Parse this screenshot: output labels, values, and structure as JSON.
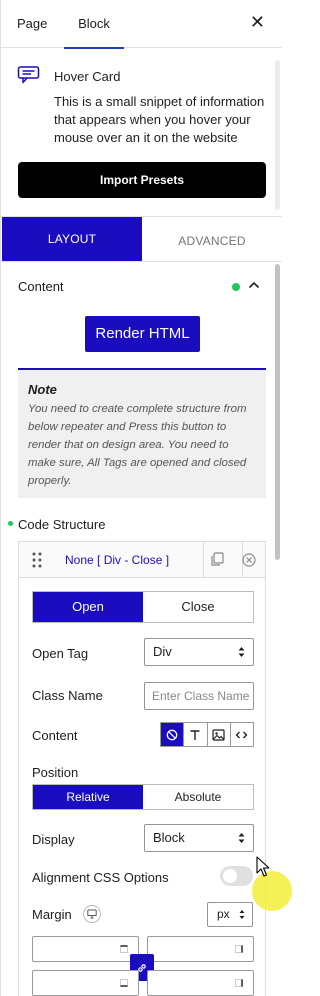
{
  "header": {
    "tabs": [
      "Page",
      "Block"
    ],
    "active_tab": "Block",
    "close_icon": "close-icon"
  },
  "block": {
    "icon": "hover-card-icon",
    "name": "Hover Card",
    "description": "This is a small snippet of information that appears when you hover your mouse over an it on the website"
  },
  "import_presets_label": "Import Presets",
  "settings_tabs": {
    "layout": "LAYOUT",
    "advanced": "ADVANCED",
    "active": "LAYOUT"
  },
  "content_section": {
    "title": "Content",
    "render_button": "Render HTML",
    "note_title": "Note",
    "note_text": "You need to create complete structure from below repeater and Press this button to render that on design area. You need to make sure, All Tags are opened and closed properly."
  },
  "code_structure": {
    "title": "Code Structure",
    "item_title": "None [ Div - Close ]",
    "open_close": [
      "Open",
      "Close"
    ],
    "open_close_selected": "Open",
    "open_tag_label": "Open Tag",
    "open_tag_value": "Div",
    "class_name_label": "Class Name",
    "class_name_placeholder": "Enter Class Name",
    "content_label": "Content",
    "content_options": [
      "none-icon",
      "text-icon",
      "image-icon",
      "code-icon"
    ],
    "content_selected": "none-icon",
    "position_label": "Position",
    "position_options": [
      "Relative",
      "Absolute"
    ],
    "position_selected": "Relative",
    "display_label": "Display",
    "display_value": "Block",
    "alignment_label": "Alignment CSS Options",
    "alignment_enabled": false,
    "margin_label": "Margin",
    "margin_unit": "px"
  },
  "colors": {
    "accent": "#1a0dbf",
    "status_green": "#22c55e",
    "import_button": "#000000"
  }
}
